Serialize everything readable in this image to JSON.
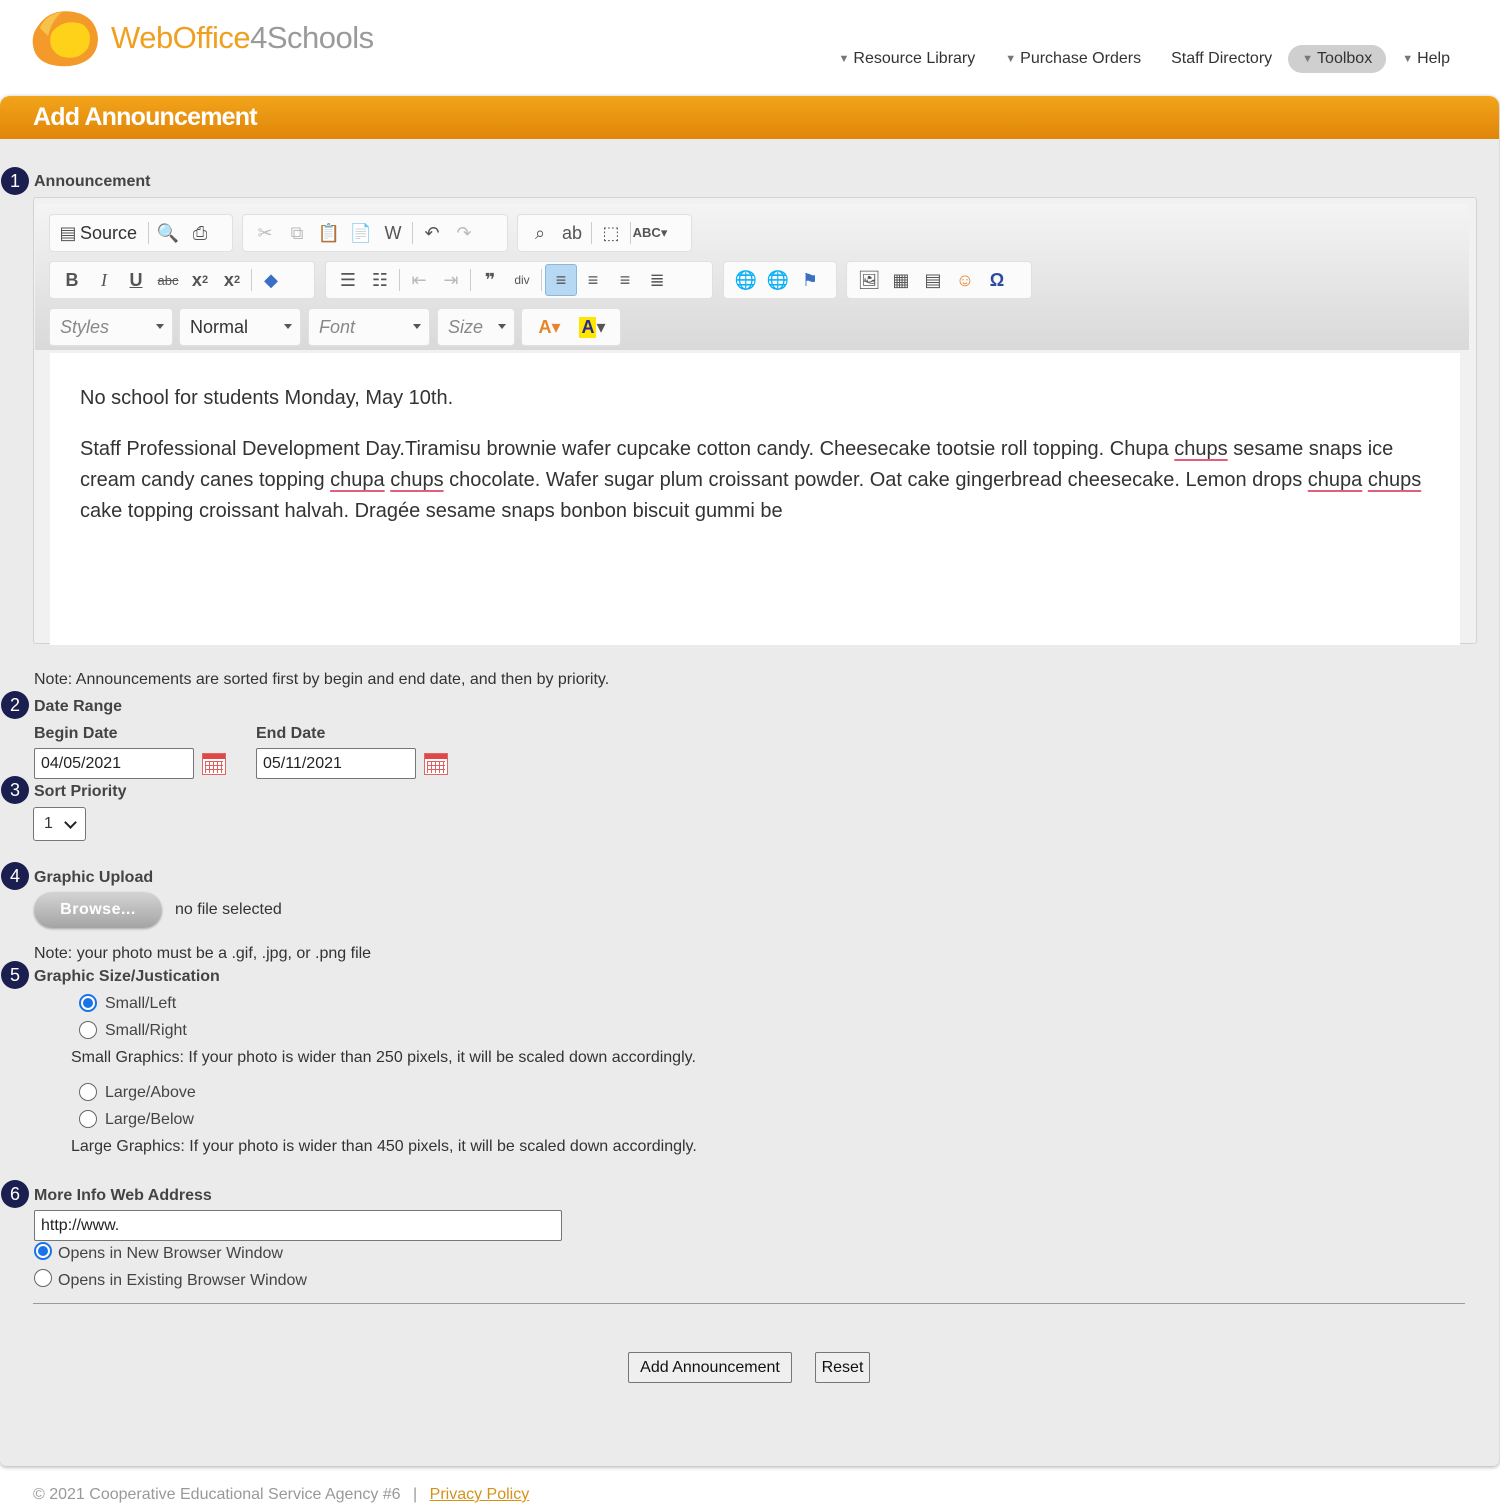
{
  "brand": {
    "name_part1": "WebOffice",
    "name_part2": "4Schools"
  },
  "nav": [
    {
      "label": "Resource Library",
      "dropdown": true
    },
    {
      "label": "Purchase Orders",
      "dropdown": true
    },
    {
      "label": "Staff Directory",
      "dropdown": false
    },
    {
      "label": "Toolbox",
      "dropdown": true,
      "active": true
    },
    {
      "label": "Help",
      "dropdown": true
    }
  ],
  "page_title": "Add Announcement",
  "steps": [
    "1",
    "2",
    "3",
    "4",
    "5",
    "6"
  ],
  "announcement": {
    "label": "Announcement",
    "toolbar": {
      "source_label": "Source",
      "styles": "Styles",
      "format": "Normal",
      "font": "Font",
      "size": "Size"
    },
    "content": {
      "line1": "No school for students Monday, May 10th.",
      "p2_a": "Staff Professional Development Day.Tiramisu brownie wafer cupcake cotton candy. Cheesecake tootsie roll topping. Chupa ",
      "p2_b": "chups",
      "p2_c": " sesame snaps ice cream candy canes topping ",
      "p2_d": "chupa",
      "p2_e": " ",
      "p2_f": "chups",
      "p2_g": " chocolate. Wafer sugar plum croissant powder. Oat cake gingerbread cheesecake. Lemon drops ",
      "p2_h": "chupa",
      "p2_i": " ",
      "p2_j": "chups",
      "p2_k": " cake topping croissant halvah. Dragée sesame snaps bonbon biscuit gummi be"
    }
  },
  "sort_note": "Note: Announcements are sorted first by begin and end date, and then by priority.",
  "date_range": {
    "label": "Date Range",
    "begin_label": "Begin Date",
    "begin_value": "04/05/2021",
    "end_label": "End Date",
    "end_value": "05/11/2021"
  },
  "sort_priority": {
    "label": "Sort Priority",
    "value": "1"
  },
  "graphic_upload": {
    "label": "Graphic Upload",
    "browse": "Browse...",
    "status": "no file selected",
    "note": "Note: your photo must be a .gif, .jpg, or .png file"
  },
  "graphic_size": {
    "label": "Graphic Size/Justication",
    "options": [
      "Small/Left",
      "Small/Right",
      "Large/Above",
      "Large/Below"
    ],
    "selected": "Small/Left",
    "small_note": "Small Graphics: If your photo is wider than 250 pixels, it will be scaled down accordingly.",
    "large_note": "Large Graphics: If your photo is wider than 450 pixels, it will be scaled down accordingly."
  },
  "more_info": {
    "label": "More Info Web Address",
    "value": "http://www.",
    "options": [
      "Opens in New Browser Window",
      "Opens in Existing Browser Window"
    ],
    "selected": "Opens in New Browser Window"
  },
  "buttons": {
    "submit": "Add Announcement",
    "reset": "Reset"
  },
  "footer": {
    "copyright": "© 2021 Cooperative Educational Service Agency #6",
    "separator": "|",
    "privacy": "Privacy Policy"
  }
}
